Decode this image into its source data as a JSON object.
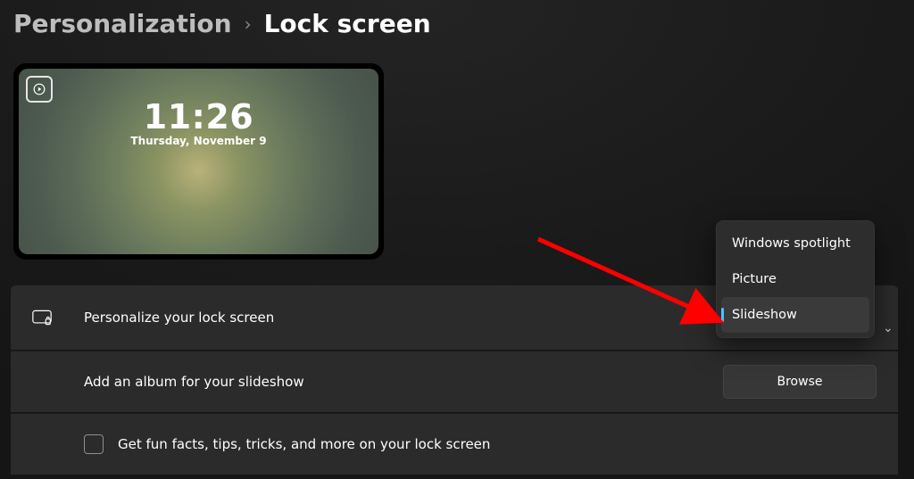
{
  "breadcrumb": {
    "parent": "Personalization",
    "separator": "›",
    "current": "Lock screen"
  },
  "preview": {
    "time": "11:26",
    "date": "Thursday, November 9"
  },
  "rows": {
    "personalize": {
      "label": "Personalize your lock screen"
    },
    "album": {
      "label": "Add an album for your slideshow",
      "button": "Browse"
    },
    "funfacts": {
      "label": "Get fun facts, tips, tricks, and more on your lock screen",
      "checked": false
    }
  },
  "dropdown": {
    "options": {
      "spotlight": "Windows spotlight",
      "picture": "Picture",
      "slideshow": "Slideshow"
    },
    "selected": "slideshow"
  }
}
